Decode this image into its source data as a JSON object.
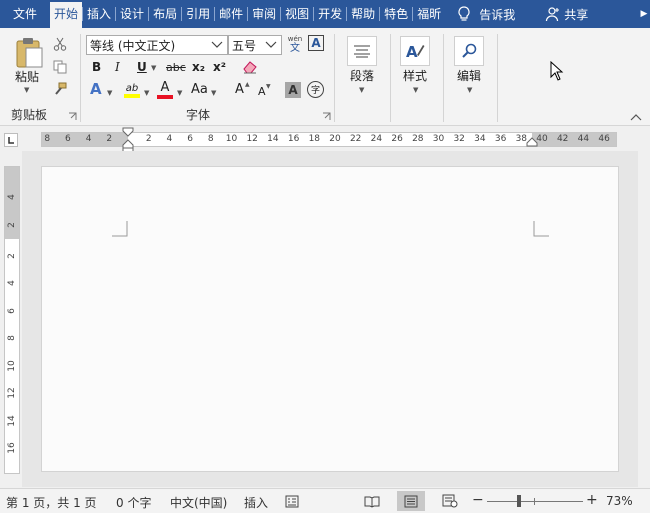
{
  "tabs": {
    "file": "文件",
    "home": "开始",
    "insert": "插入",
    "design": "设计",
    "layout": "布局",
    "references": "引用",
    "mailings": "邮件",
    "review": "审阅",
    "view": "视图",
    "developer": "开发",
    "help": "帮助",
    "special": "特色",
    "foxit": "福昕",
    "tell_me": "告诉我",
    "share": "共享"
  },
  "clipboard": {
    "paste_label": "粘贴",
    "group_label": "剪贴板"
  },
  "font": {
    "font_name": "等线 (中文正文)",
    "font_size": "五号",
    "phonetic_top": "wén",
    "phonetic_bottom": "文",
    "border_char": "A",
    "bold": "B",
    "italic": "I",
    "underline": "U",
    "strikethrough": "abc",
    "subscript": "x₂",
    "superscript": "x²",
    "text_effects": "A",
    "highlight": "ab",
    "font_color": "A",
    "change_case": "Aa",
    "grow": "A",
    "shrink": "A",
    "shading": "A",
    "enclose": "字",
    "group_label": "字体"
  },
  "paragraph": {
    "label": "段落"
  },
  "styles": {
    "label": "样式"
  },
  "editing": {
    "label": "编辑"
  },
  "ruler": {
    "h_left": [
      "8",
      "6",
      "4",
      "2"
    ],
    "h_right": [
      "2",
      "4",
      "6",
      "8",
      "10",
      "12",
      "14",
      "16",
      "18",
      "20",
      "22",
      "24",
      "26",
      "28",
      "30",
      "32",
      "34",
      "36",
      "38",
      "40",
      "42",
      "44",
      "46"
    ],
    "v_top": [
      "4",
      "2"
    ],
    "v_bottom": [
      "2",
      "4",
      "6",
      "8",
      "10",
      "12",
      "14",
      "16"
    ]
  },
  "status": {
    "page": "第 1 页，共 1 页",
    "words": "0 个字",
    "language": "中文(中国)",
    "mode": "插入",
    "zoom": "73%",
    "zoom_minus": "−",
    "zoom_plus": "+"
  },
  "colors": {
    "accent": "#2b579a",
    "highlight": "#ffff00",
    "font_color": "#e81123"
  }
}
